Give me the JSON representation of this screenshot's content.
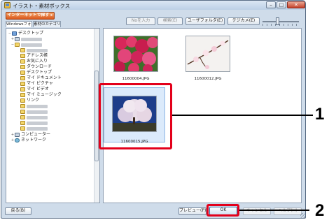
{
  "window": {
    "title": "イラスト・素材ボックス",
    "controls": {
      "minimize": "–",
      "maximize": "□",
      "close": "✕"
    }
  },
  "toolbar": {
    "internet_button": "インターネットで探す ▸",
    "tabs": [
      {
        "label": "Windowsフォルダ",
        "active": true
      },
      {
        "label": "素材のカテゴリ",
        "active": false
      }
    ],
    "no_input_button": "Noを入力",
    "search_button": "検索(E)",
    "user_folder_button": "ユーザフォルダ(E)",
    "camera_button": "デジカメ(E)"
  },
  "tree": {
    "items": [
      {
        "label": "デスクトップ",
        "icon": "desktop-icon",
        "expander": "−",
        "blurred": false
      },
      {
        "label": "",
        "icon": "computer-icon",
        "expander": "+",
        "blurred": true
      },
      {
        "label": "",
        "icon": "user-folder-icon",
        "expander": "−",
        "blurred": true
      },
      {
        "label": "",
        "icon": "folder-icon",
        "expander": "",
        "blurred": true
      },
      {
        "label": "アドレス帳",
        "icon": "folder-icon",
        "expander": "",
        "blurred": false
      },
      {
        "label": "お気に入り",
        "icon": "folder-icon",
        "expander": "",
        "blurred": false
      },
      {
        "label": "ダウンロード",
        "icon": "folder-icon",
        "expander": "",
        "blurred": false
      },
      {
        "label": "デスクトップ",
        "icon": "folder-icon",
        "expander": "",
        "blurred": false
      },
      {
        "label": "マイ ドキュメント",
        "icon": "folder-icon",
        "expander": "",
        "blurred": false
      },
      {
        "label": "マイ ピクチャ",
        "icon": "folder-icon",
        "expander": "",
        "blurred": false
      },
      {
        "label": "マイ ビデオ",
        "icon": "folder-icon",
        "expander": "",
        "blurred": false
      },
      {
        "label": "マイ ミュージック",
        "icon": "folder-icon",
        "expander": "",
        "blurred": false
      },
      {
        "label": "リンク",
        "icon": "folder-icon",
        "expander": "",
        "blurred": false
      },
      {
        "label": "",
        "icon": "folder-icon",
        "expander": "",
        "blurred": true
      },
      {
        "label": "",
        "icon": "folder-icon",
        "expander": "",
        "blurred": true
      },
      {
        "label": "",
        "icon": "folder-icon",
        "expander": "",
        "blurred": true
      },
      {
        "label": "",
        "icon": "folder-icon",
        "expander": "",
        "blurred": true
      },
      {
        "label": "",
        "icon": "folder-icon",
        "expander": "",
        "blurred": true
      },
      {
        "label": "コンピューター",
        "icon": "computer-icon",
        "expander": "+",
        "blurred": false
      },
      {
        "label": "ネットワーク",
        "icon": "network-icon",
        "expander": "+",
        "blurred": false
      }
    ]
  },
  "thumbnails": [
    {
      "filename": "11600004.JPG",
      "image": "red-blossom-photo",
      "selected": false
    },
    {
      "filename": "11600012.JPG",
      "image": "white-blossom-photo",
      "selected": false
    },
    {
      "filename": "11600015.JPG",
      "image": "cherry-tree-photo",
      "selected": true
    }
  ],
  "bottom": {
    "return_button": "戻る(B)",
    "preview_button": "プレビュー(P)",
    "ok_button": "OK",
    "cancel_button": "キャンセル",
    "help_button": "ヘルプ(H)"
  },
  "callouts": {
    "one": "1",
    "two": "2"
  },
  "colors": {
    "callout_red": "#e3001b",
    "internet_button": "#e06a28",
    "selection_blue": "#dbeafb"
  }
}
